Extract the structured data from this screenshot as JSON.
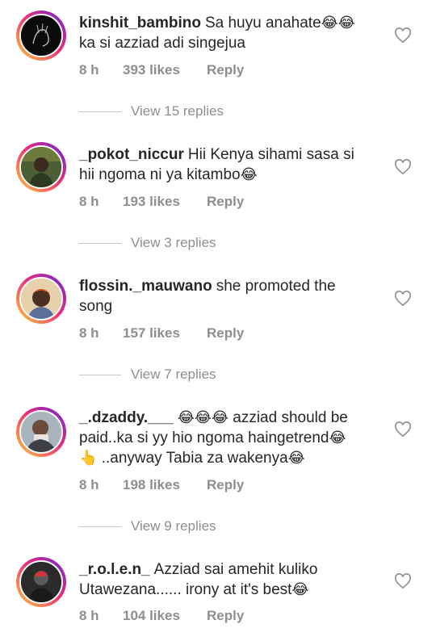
{
  "comments": [
    {
      "username": "kinshit_bambino",
      "text_line1": "Sa huyu anahate",
      "emoji_line1": "😂😂",
      "text_line2": "ka si azziad adi singejua",
      "time": "8 h",
      "likes": "393 likes",
      "reply": "Reply",
      "view_replies": "View 15 replies"
    },
    {
      "username": "_pokot_niccur",
      "text_line1": "Hii Kenya sihami sasa si",
      "text_line2": "hii ngoma ni ya kitambo",
      "emoji_line2": "😂",
      "time": "8 h",
      "likes": "193 likes",
      "reply": "Reply",
      "view_replies": "View 3 replies"
    },
    {
      "username": "flossin._mauwano",
      "text_line1": "she promoted the",
      "text_line2": "song",
      "time": "8 h",
      "likes": "157 likes",
      "reply": "Reply",
      "view_replies": "View 7 replies"
    },
    {
      "username": "_.dzaddy.___",
      "emoji_line1": "😂😂😂",
      "text_line1": "azziad should be",
      "text_line2": "paid..ka si yy hio ngoma haingetrend",
      "emoji_line2": "😂",
      "emoji_line3a": "👆",
      "text_line3": "..anyway Tabia za wakenya",
      "emoji_line3b": "😂",
      "time": "8 h",
      "likes": "198 likes",
      "reply": "Reply",
      "view_replies": "View 9 replies"
    },
    {
      "username": "_r.o.l.e.n_",
      "text_line1": "Azziad sai amehit kuliko",
      "text_line2": "Utawezana...... irony at it's best",
      "emoji_line2": "😂",
      "time": "8 h",
      "likes": "104 likes",
      "reply": "Reply"
    }
  ]
}
